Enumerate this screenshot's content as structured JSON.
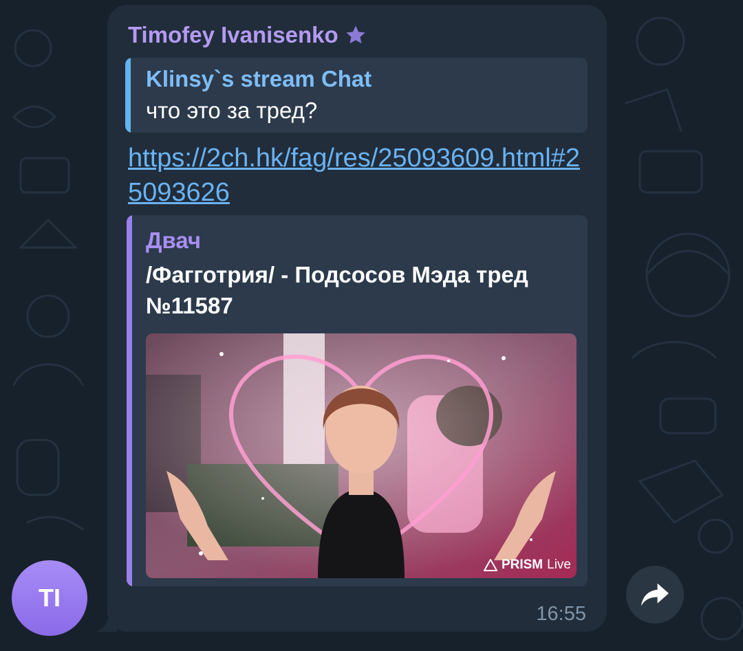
{
  "message": {
    "sender": "Timofey Ivanisenko",
    "sender_icon": "premium-star-icon",
    "reply": {
      "title": "Klinsy`s stream Chat",
      "text": "что это за тред?"
    },
    "link": "https://2ch.hk/fag/res/25093609.html#25093626",
    "preview": {
      "site_name": "Двач",
      "title": "/Фагготрия/ - Подсосов Мэда тред №11587",
      "watermark_brand": "PRISM",
      "watermark_suffix": "Live"
    },
    "time": "16:55"
  },
  "avatar": {
    "initials": "TI"
  },
  "actions": {
    "forward_icon": "forward-arrow-icon"
  },
  "colors": {
    "background": "#17212b",
    "bubble": "#212d3b",
    "sender_name": "#b49bf2",
    "reply_accent": "#63b3ed",
    "link": "#6ab3f3",
    "preview_accent": "#9a80ea"
  }
}
